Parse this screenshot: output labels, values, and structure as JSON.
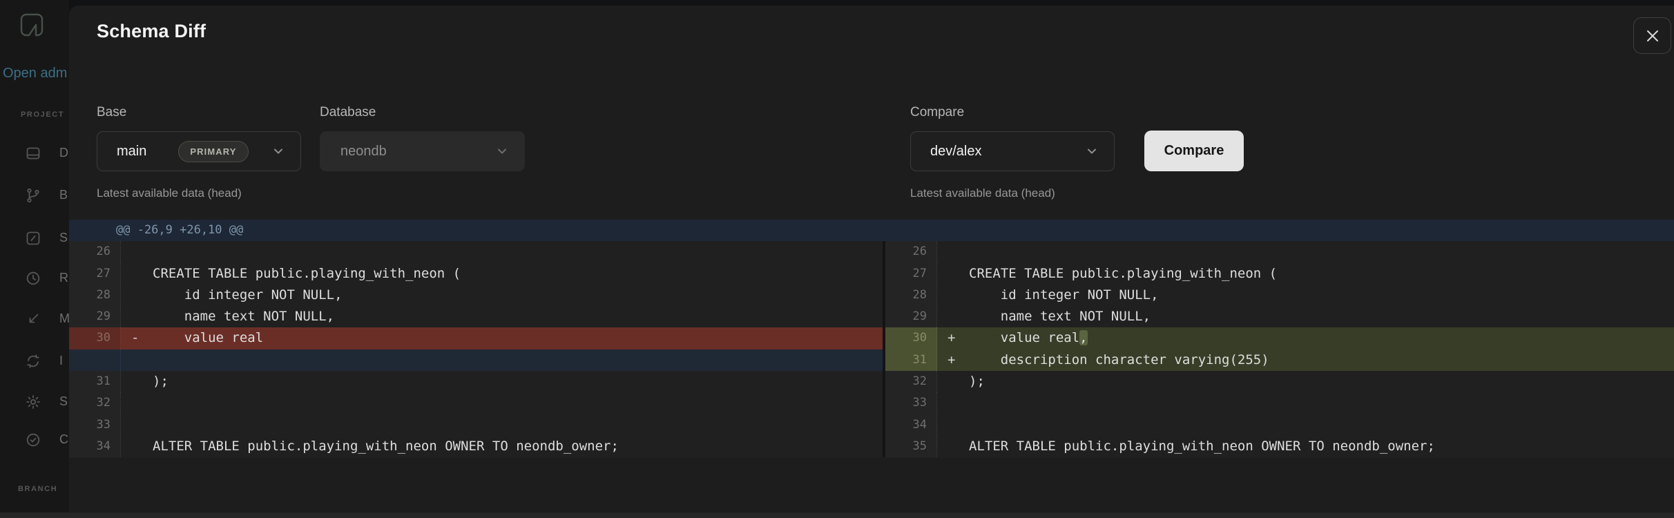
{
  "modal": {
    "title": "Schema Diff"
  },
  "form": {
    "base": {
      "label": "Base",
      "value": "main",
      "badge": "PRIMARY",
      "hint": "Latest available data (head)"
    },
    "database": {
      "label": "Database",
      "value": "neondb"
    },
    "compare": {
      "label": "Compare",
      "value": "dev/alex",
      "hint": "Latest available data (head)",
      "button_label": "Compare"
    }
  },
  "diff": {
    "hunk_header": "@@ -26,9 +26,10 @@",
    "left_rows": [
      {
        "num": "26",
        "marker": "",
        "code": "",
        "type": "context"
      },
      {
        "num": "27",
        "marker": "",
        "code": "CREATE TABLE public.playing_with_neon (",
        "type": "context"
      },
      {
        "num": "28",
        "marker": "",
        "code": "    id integer NOT NULL,",
        "type": "context"
      },
      {
        "num": "29",
        "marker": "",
        "code": "    name text NOT NULL,",
        "type": "context"
      },
      {
        "num": "30",
        "marker": "-",
        "code": "    value real",
        "type": "removed"
      },
      {
        "num": "",
        "marker": "",
        "code": "",
        "type": "spacer"
      },
      {
        "num": "31",
        "marker": "",
        "code": ");",
        "type": "context"
      },
      {
        "num": "32",
        "marker": "",
        "code": "",
        "type": "context"
      },
      {
        "num": "33",
        "marker": "",
        "code": "",
        "type": "context"
      },
      {
        "num": "34",
        "marker": "",
        "code": "ALTER TABLE public.playing_with_neon OWNER TO neondb_owner;",
        "type": "context"
      }
    ],
    "right_rows": [
      {
        "num": "26",
        "marker": "",
        "code": "",
        "type": "context"
      },
      {
        "num": "27",
        "marker": "",
        "code": "CREATE TABLE public.playing_with_neon (",
        "type": "context"
      },
      {
        "num": "28",
        "marker": "",
        "code": "    id integer NOT NULL,",
        "type": "context"
      },
      {
        "num": "29",
        "marker": "",
        "code": "    name text NOT NULL,",
        "type": "context"
      },
      {
        "num": "30",
        "marker": "+",
        "code": "    value real",
        "highlight": ",",
        "type": "added"
      },
      {
        "num": "31",
        "marker": "+",
        "code": "    description character varying(255)",
        "type": "added"
      },
      {
        "num": "32",
        "marker": "",
        "code": ");",
        "type": "context"
      },
      {
        "num": "33",
        "marker": "",
        "code": "",
        "type": "context"
      },
      {
        "num": "34",
        "marker": "",
        "code": "",
        "type": "context"
      },
      {
        "num": "35",
        "marker": "",
        "code": "ALTER TABLE public.playing_with_neon OWNER TO neondb_owner;",
        "type": "context"
      }
    ]
  },
  "sidebar": {
    "open_admin": "Open adm",
    "project_label": "PROJECT",
    "branch_label": "BRANCH",
    "items": [
      {
        "icon": "dashboard-icon",
        "letter": "D"
      },
      {
        "icon": "branch-icon",
        "letter": "B"
      },
      {
        "icon": "sql-editor-icon",
        "letter": "S"
      },
      {
        "icon": "restore-icon",
        "letter": "R"
      },
      {
        "icon": "monitoring-icon",
        "letter": "M"
      },
      {
        "icon": "integrations-icon",
        "letter": "I"
      },
      {
        "icon": "settings-icon",
        "letter": "S"
      },
      {
        "icon": "check-circle-icon",
        "letter": "C"
      }
    ]
  },
  "colors": {
    "removed_bg": "#6b2e27",
    "added_bg": "#383d27",
    "added_gutter_bg": "#4b5232",
    "word_add_bg": "#5a6440",
    "hunk_header_bg": "#1d2736",
    "spacer_bg": "#1f2936",
    "button_bg": "#e4e4e4",
    "open_admin_text": "#3c6e87"
  }
}
